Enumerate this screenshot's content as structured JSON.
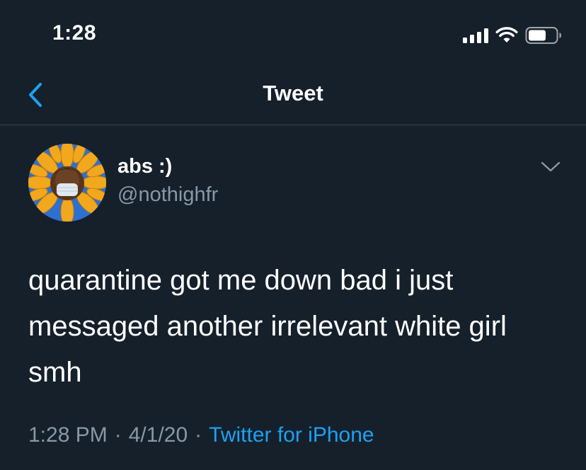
{
  "status_bar": {
    "time": "1:28",
    "icons": [
      "signal-icon",
      "wifi-icon",
      "battery-icon"
    ]
  },
  "nav": {
    "back_icon": "chevron-left-icon",
    "title": "Tweet",
    "accent_color": "#1da1f2"
  },
  "tweet": {
    "author_name": "abs :)",
    "author_handle": "@nothighfr",
    "avatar_icon": "sunflower-avatar",
    "caret_icon": "chevron-down-icon",
    "text": "quarantine got me down bad i just\nmessaged another irrelevant white girl\nsmh",
    "time": "1:28 PM",
    "date": "4/1/20",
    "separator": "·",
    "source": "Twitter for iPhone"
  },
  "colors": {
    "background": "#15202b",
    "secondary_text": "#8899a6",
    "divider": "#38444d",
    "link": "#1da1f2"
  }
}
